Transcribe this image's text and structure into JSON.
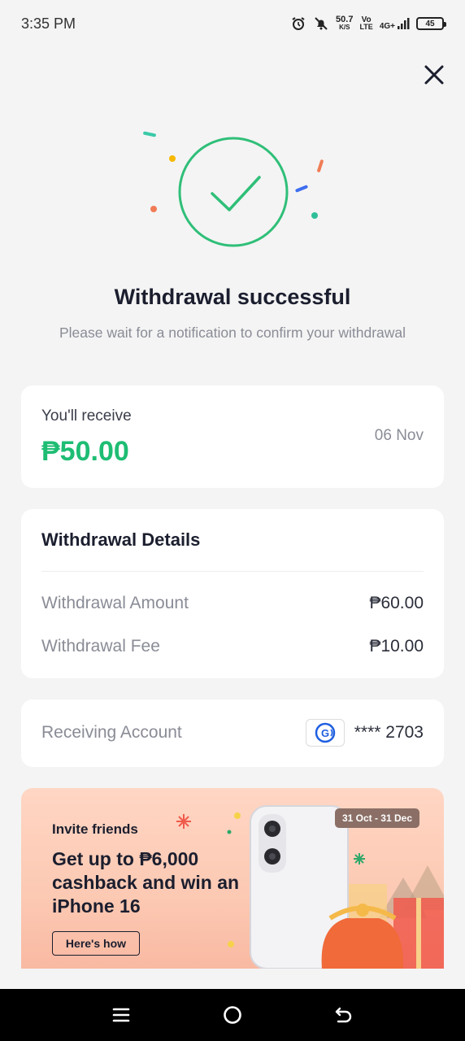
{
  "status_bar": {
    "time": "3:35 PM",
    "net_speed": "50.7",
    "net_unit": "K/S",
    "volte_top": "Vo",
    "volte_bottom": "LTE",
    "signal_label": "4G+",
    "battery": "45"
  },
  "header": {
    "close_icon": "close-icon"
  },
  "success": {
    "title": "Withdrawal successful",
    "subtitle": "Please wait for a notification to confirm your withdrawal"
  },
  "receive": {
    "label": "You'll receive",
    "amount": "₱50.00",
    "date": "06 Nov"
  },
  "details": {
    "title": "Withdrawal Details",
    "rows": [
      {
        "label": "Withdrawal Amount",
        "value": "₱60.00"
      },
      {
        "label": "Withdrawal Fee",
        "value": "₱10.00"
      }
    ]
  },
  "account": {
    "label": "Receiving Account",
    "number": "**** 2703",
    "provider_icon": "gcash-logo-icon"
  },
  "banner": {
    "invite": "Invite friends",
    "headline": "Get up to ₱6,000 cashback and win an iPhone 16",
    "button": "Here's how",
    "date_range": "31 Oct - 31 Dec"
  },
  "nav": {
    "menu_icon": "menu-icon",
    "home_icon": "home-icon",
    "back_icon": "back-icon"
  },
  "colors": {
    "accent_green": "#1ebd73",
    "ring_green": "#2fbf78",
    "background": "#f4f4f4"
  }
}
